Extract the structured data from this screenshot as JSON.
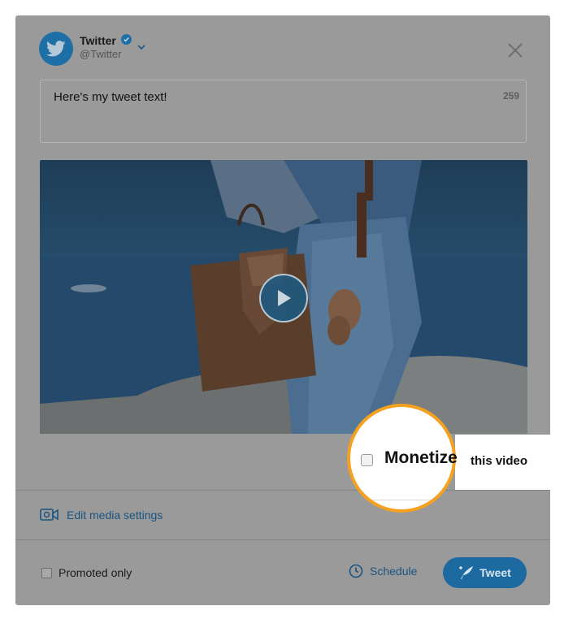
{
  "account": {
    "name": "Twitter",
    "handle": "@Twitter"
  },
  "composer": {
    "tweet_text": "Here's my tweet text!",
    "char_count": "259"
  },
  "media": {
    "type": "video"
  },
  "monetize": {
    "label": "Monetize",
    "suffix": "this video",
    "checked": false
  },
  "footer": {
    "edit_media_label": "Edit media settings",
    "promoted_label": "Promoted only",
    "schedule_label": "Schedule",
    "tweet_button_label": "Tweet"
  },
  "colors": {
    "accent": "#1da1f2",
    "highlight_ring": "#f4a11f",
    "overlay": "#9a9a9a"
  }
}
